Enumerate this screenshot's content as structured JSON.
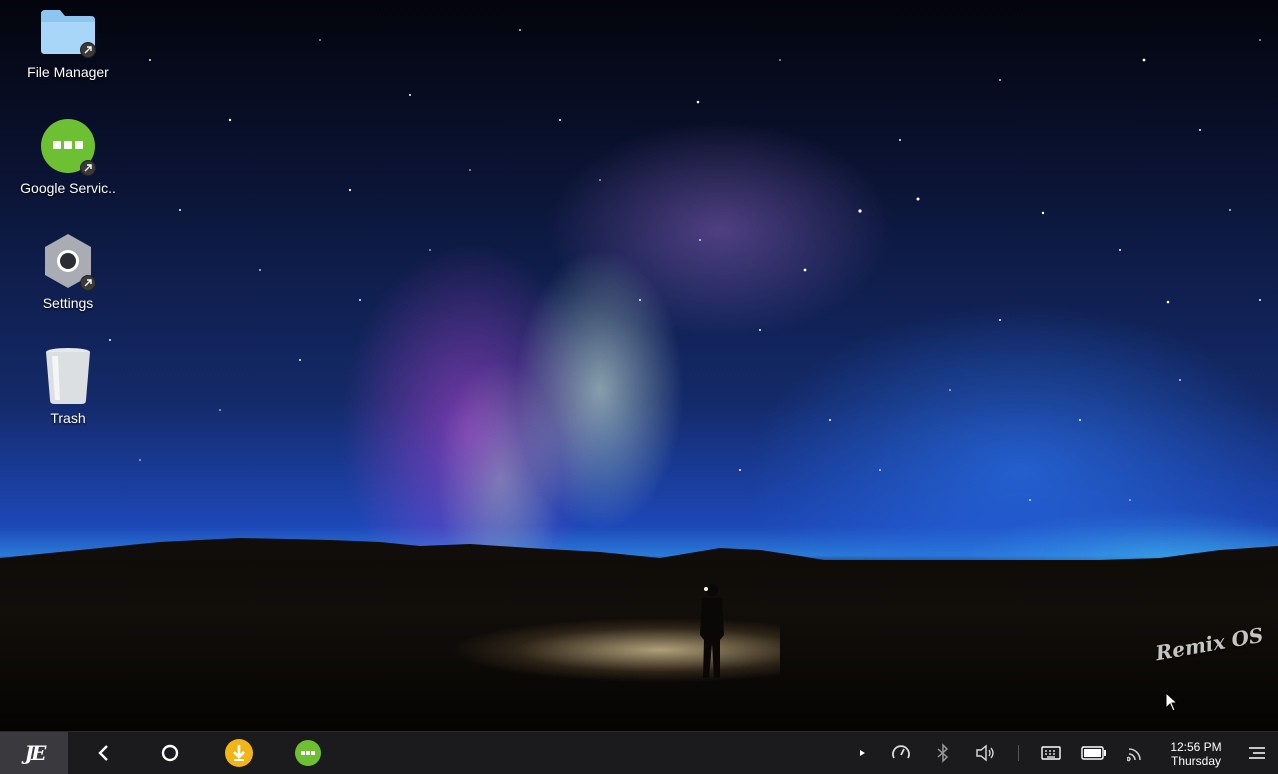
{
  "desktop": {
    "icons": [
      {
        "label": "File Manager",
        "icon": "folder-icon"
      },
      {
        "label": "Google Servic..",
        "icon": "google-services-icon"
      },
      {
        "label": "Settings",
        "icon": "settings-icon"
      },
      {
        "label": "Trash",
        "icon": "trash-icon"
      }
    ],
    "watermark": "Remix OS"
  },
  "taskbar": {
    "start_logo": "JE",
    "clock": {
      "time": "12:56 PM",
      "day": "Thursday"
    },
    "colors": {
      "background": "#1b1b1d",
      "download_app": "#f2b518",
      "google_services_app": "#6cc031"
    }
  }
}
